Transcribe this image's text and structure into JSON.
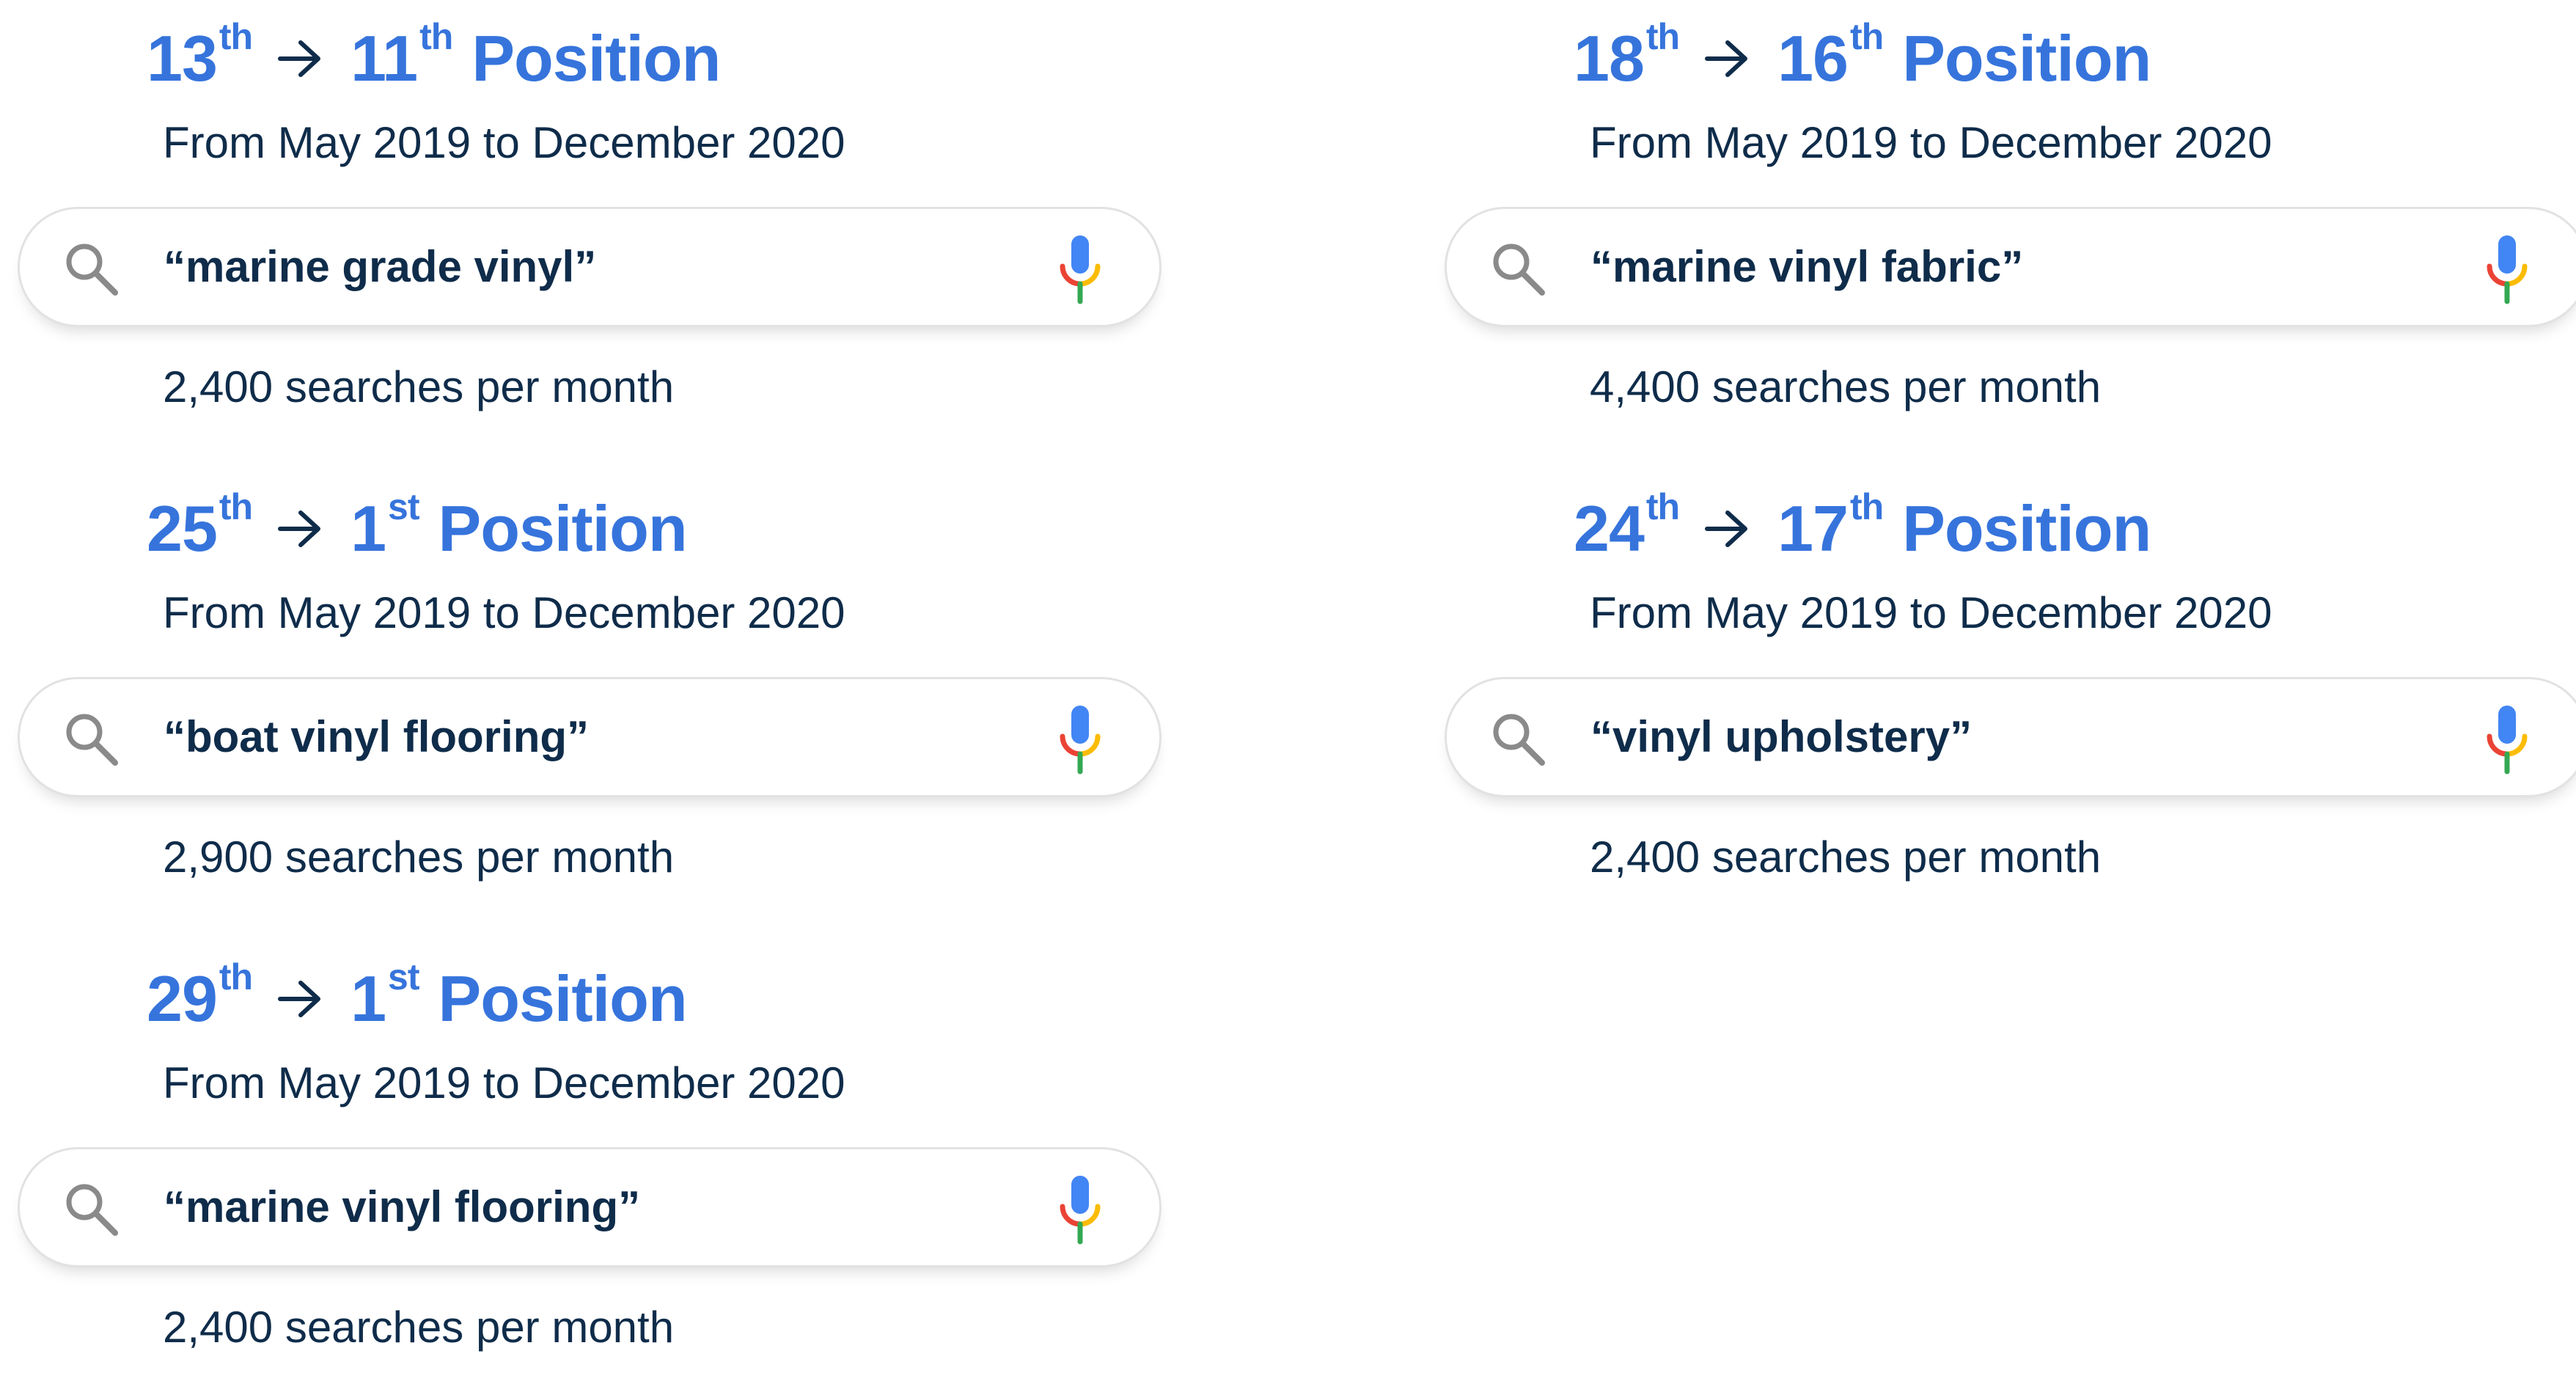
{
  "results": [
    {
      "from_rank": "13",
      "from_suffix": "th",
      "to_rank": "11",
      "to_suffix": "th",
      "position_word": "Position",
      "period": "From May 2019 to December 2020",
      "query": "“marine grade vinyl”",
      "volume": "2,400 searches per month"
    },
    {
      "from_rank": "18",
      "from_suffix": "th",
      "to_rank": "16",
      "to_suffix": "th",
      "position_word": "Position",
      "period": "From May 2019 to December 2020",
      "query": "“marine vinyl fabric”",
      "volume": "4,400 searches per month"
    },
    {
      "from_rank": "25",
      "from_suffix": "th",
      "to_rank": "1",
      "to_suffix": "st",
      "position_word": "Position",
      "period": "From May 2019 to December 2020",
      "query": "“boat vinyl flooring”",
      "volume": "2,900 searches per month"
    },
    {
      "from_rank": "24",
      "from_suffix": "th",
      "to_rank": "17",
      "to_suffix": "th",
      "position_word": "Position",
      "period": "From May 2019 to December 2020",
      "query": "“vinyl upholstery”",
      "volume": "2,400 searches per month"
    },
    {
      "from_rank": "29",
      "from_suffix": "th",
      "to_rank": "1",
      "to_suffix": "st",
      "position_word": "Position",
      "period": "From May 2019 to December 2020",
      "query": "“marine vinyl flooring”",
      "volume": "2,400 searches per month"
    }
  ],
  "icons": {
    "search": "search-icon",
    "microphone": "microphone-icon",
    "arrow": "right-arrow-icon"
  },
  "colors": {
    "heading": "#3674dc",
    "text": "#0f2c4a",
    "bar_border": "#e2e2e2",
    "mic_blue": "#4285f4",
    "mic_red": "#ea4335",
    "mic_yellow": "#fbbc05",
    "mic_green": "#34a853",
    "search_icon_gray": "#8a8a8a"
  }
}
